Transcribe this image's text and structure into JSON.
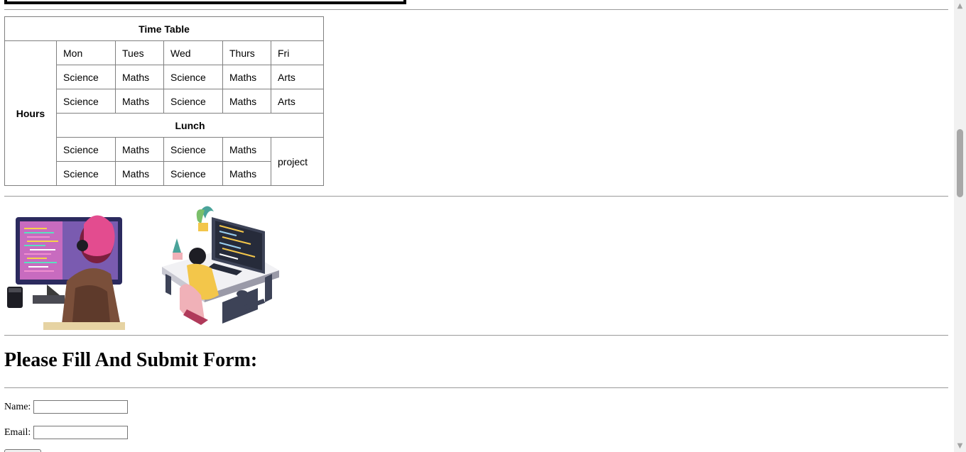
{
  "timetable": {
    "caption": "Time Table",
    "row_header": "Hours",
    "days": [
      "Mon",
      "Tues",
      "Wed",
      "Thurs",
      "Fri"
    ],
    "morning": [
      [
        "Science",
        "Maths",
        "Science",
        "Maths",
        "Arts"
      ],
      [
        "Science",
        "Maths",
        "Science",
        "Maths",
        "Arts"
      ]
    ],
    "lunch": "Lunch",
    "afternoon": [
      [
        "Science",
        "Maths",
        "Science",
        "Maths"
      ],
      [
        "Science",
        "Maths",
        "Science",
        "Maths"
      ]
    ],
    "afternoon_friday": "project"
  },
  "images": [
    {
      "name": "developer-illustration-1",
      "palette": [
        "#2b2a5e",
        "#e34c8f",
        "#7a4f3a"
      ]
    },
    {
      "name": "developer-illustration-2",
      "palette": [
        "#f3c64a",
        "#3d4357",
        "#f0b1b8"
      ]
    }
  ],
  "form": {
    "title": "Please Fill And Submit Form:",
    "name_label": "Name:",
    "name_value": "",
    "email_label": "Email:",
    "email_value": ""
  }
}
